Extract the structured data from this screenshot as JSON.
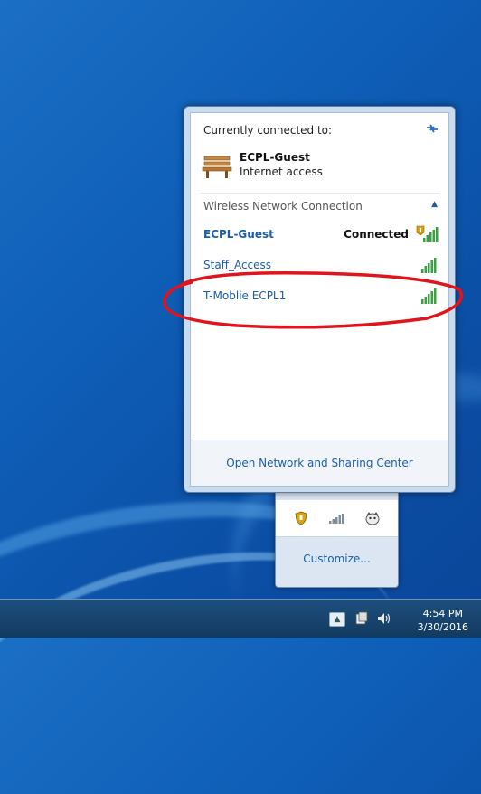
{
  "flyout": {
    "header": "Currently connected to:",
    "current": {
      "name": "ECPL-Guest",
      "status": "Internet access"
    },
    "section_title": "Wireless Network Connection",
    "networks": [
      {
        "name": "ECPL-Guest",
        "status": "Connected",
        "secure_warning": true
      },
      {
        "name": "Staff_Access",
        "status": ""
      },
      {
        "name": "T-Moblie ECPL1",
        "status": ""
      }
    ],
    "footer_link": "Open Network and Sharing Center"
  },
  "tray_popup": {
    "customize_label": "Customize..."
  },
  "taskbar": {
    "time": "4:54 PM",
    "date": "3/30/2016",
    "show_hidden_label": "▲"
  },
  "colors": {
    "link": "#1b5ea8",
    "signal": "#3aa040",
    "annotation": "#e0141c"
  }
}
